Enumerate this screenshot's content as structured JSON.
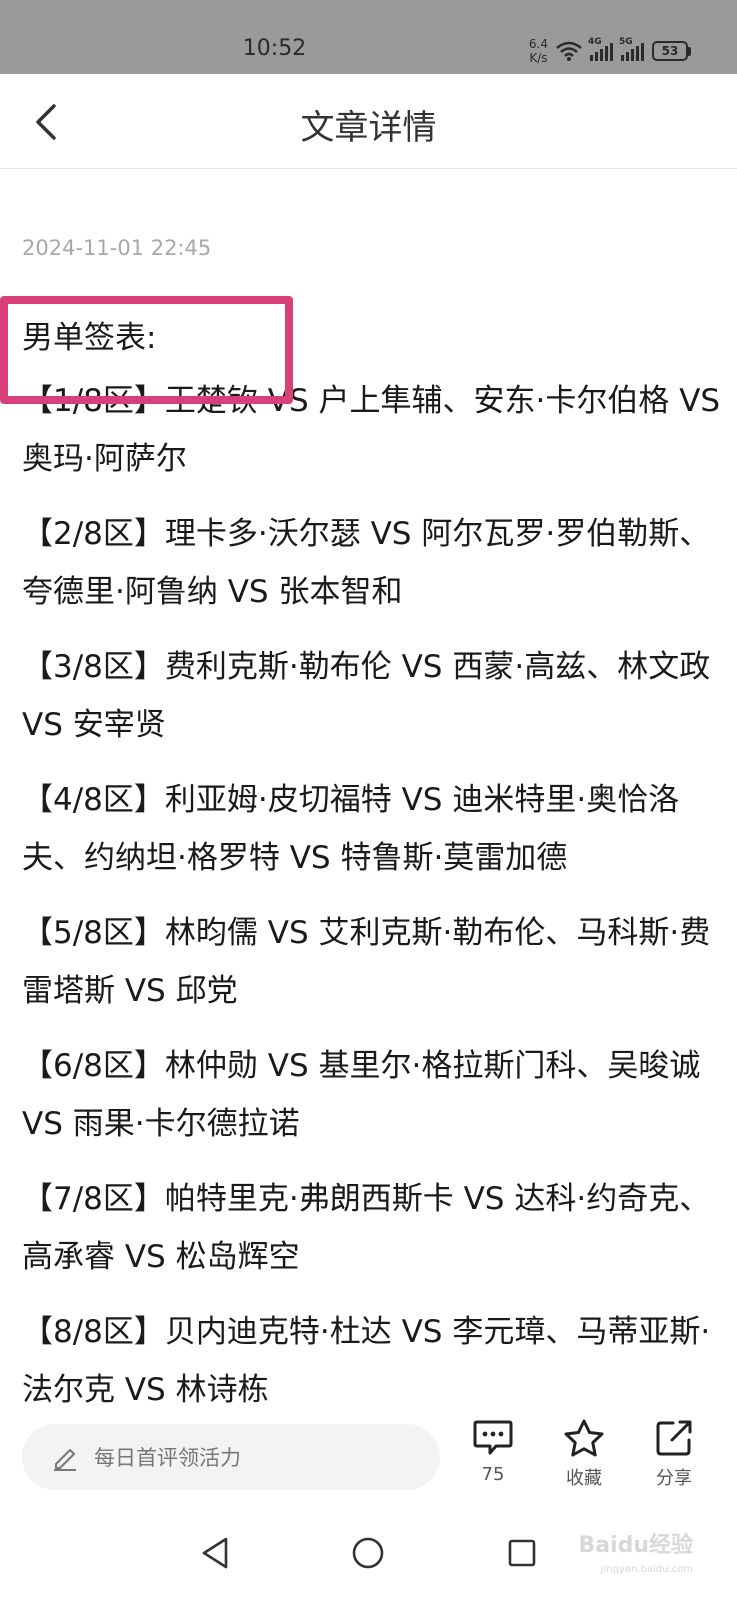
{
  "status_bar": {
    "time": "10:52",
    "net_speed_value": "6.4",
    "net_speed_unit": "K/s",
    "signal1_label": "4G",
    "signal2_label": "5G",
    "battery": "53"
  },
  "nav": {
    "title": "文章详情"
  },
  "article": {
    "date": "2024-11-01 22:45",
    "section_title": "男单签表:",
    "items": [
      "【1/8区】王楚钦 VS 户上隼辅、安东·卡尔伯格 VS 奥玛·阿萨尔",
      "【2/8区】理卡多·沃尔瑟 VS 阿尔瓦罗·罗伯勒斯、夸德里·阿鲁纳 VS 张本智和",
      "【3/8区】费利克斯·勒布伦 VS 西蒙·高兹、林文政 VS 安宰贤",
      "【4/8区】利亚姆·皮切福特 VS 迪米特里·奥恰洛夫、约纳坦·格罗特 VS 特鲁斯·莫雷加德",
      "【5/8区】林昀儒 VS 艾利克斯·勒布伦、马科斯·费雷塔斯 VS 邱党",
      "【6/8区】林仲勋 VS 基里尔·格拉斯门科、吴晙诚 VS 雨果·卡尔德拉诺",
      "【7/8区】帕特里克·弗朗西斯卡 VS 达科·约奇克、高承睿 VS 松岛辉空",
      "【8/8区】贝内迪克特·杜达 VS 李元璋、马蒂亚斯·法尔克 VS 林诗栋"
    ]
  },
  "action_bar": {
    "comment_placeholder": "每日首评领活力",
    "comment_count": "75",
    "favorite_label": "收藏",
    "share_label": "分享"
  },
  "watermark": {
    "text": "Baidu经验",
    "sub": "jingyan.baidu.com"
  },
  "colors": {
    "highlight": "#d9407a",
    "status_bar_bg": "#9a9a9a"
  }
}
